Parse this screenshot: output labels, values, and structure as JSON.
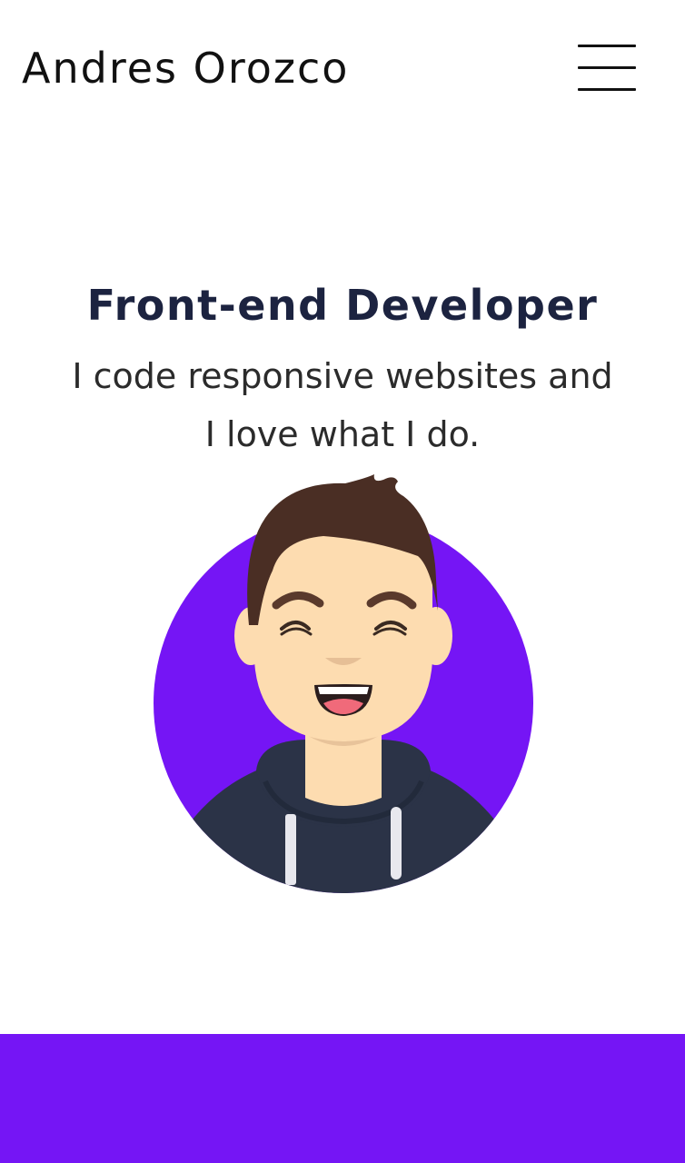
{
  "header": {
    "logo_text": "Andres Orozco",
    "menu_icon": "hamburger-menu-icon"
  },
  "hero": {
    "title": "Front-end Developer",
    "tagline_line1": "I code responsive websites and",
    "tagline_line2": "I love what I do."
  },
  "avatar": {
    "icon": "developer-avatar-illustration"
  },
  "colors": {
    "accent": "#7515f5",
    "title_text": "#1c2340",
    "body_text": "#2b2b2b",
    "hoodie": "#2b3347",
    "hair": "#4a2e24",
    "skin": "#fddcb0",
    "background": "#ffffff"
  }
}
